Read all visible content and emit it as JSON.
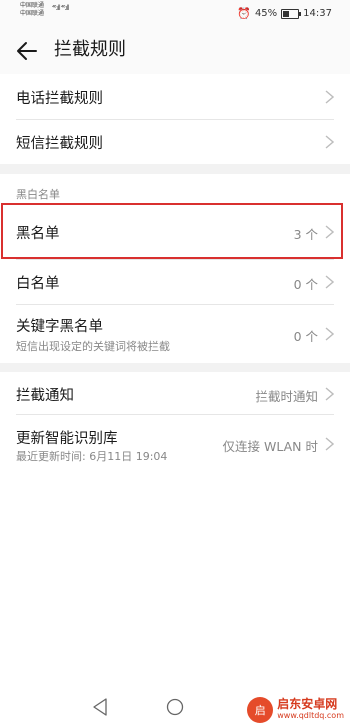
{
  "status": {
    "carrier1": "中国联通",
    "carrier2": "中国联通",
    "signal": "⁴⁶.ıll ⁴⁶.ıll",
    "battery": "45%",
    "time": "14:37",
    "alarm_icon": "alarm-icon"
  },
  "header": {
    "title": "拦截规则",
    "back_icon": "back-arrow-icon"
  },
  "rules": [
    {
      "label": "电话拦截规则"
    },
    {
      "label": "短信拦截规则"
    }
  ],
  "lists": {
    "header": "黑白名单",
    "items": [
      {
        "label": "黑名单",
        "value": "3 个"
      },
      {
        "label": "白名单",
        "value": "0 个"
      },
      {
        "label": "关键字黑名单",
        "sub": "短信出现设定的关键词将被拦截",
        "value": "0 个"
      }
    ]
  },
  "misc": [
    {
      "label": "拦截通知",
      "value": "拦截时通知"
    },
    {
      "label": "更新智能识别库",
      "sub": "最近更新时间: 6月11日 19:04",
      "value": "仅连接 WLAN 时"
    }
  ],
  "highlight_color": "#d9302f",
  "watermark": {
    "logo": "启",
    "title": "启东安卓网",
    "url": "www.qdltdq.com"
  }
}
